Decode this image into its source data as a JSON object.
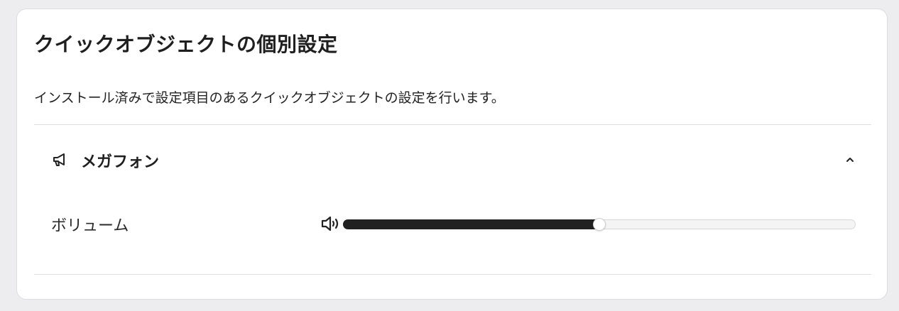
{
  "panel": {
    "title": "クイックオブジェクトの個別設定",
    "description": "インストール済みで設定項目のあるクイックオブジェクトの設定を行います。"
  },
  "sections": [
    {
      "icon": "megaphone-icon",
      "title": "メガフォン",
      "expanded": true,
      "toggle_icon": "chevron-up-icon",
      "settings": [
        {
          "label": "ボリューム",
          "icon": "speaker-volume-icon",
          "type": "slider",
          "value_fraction": 0.5
        }
      ]
    }
  ],
  "colors": {
    "page_background": "#ededef",
    "card_background": "#ffffff",
    "slider_fill": "#212121",
    "slider_track": "#f4f4f4",
    "divider": "#dedede"
  }
}
